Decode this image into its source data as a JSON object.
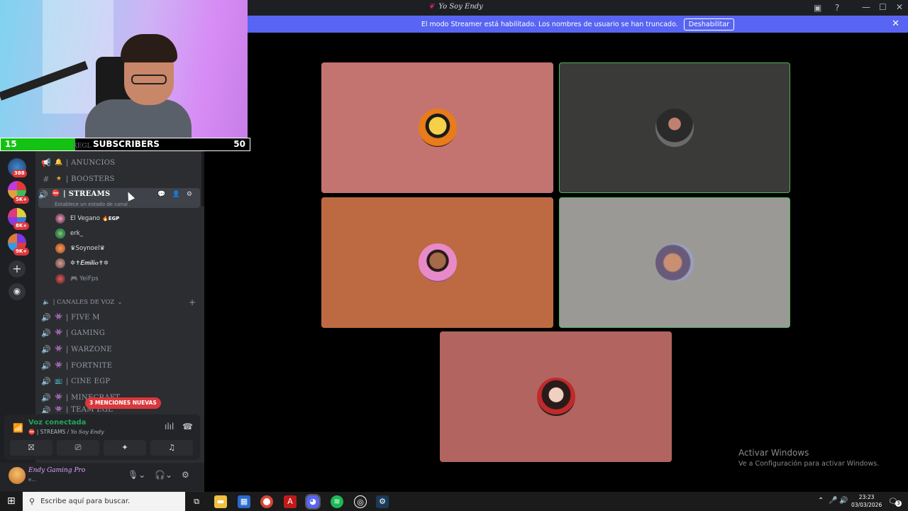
{
  "window": {
    "title": "Yo Soy Endy",
    "inbox_icon": "inbox-icon",
    "help_icon": "help-icon",
    "minimize": "—",
    "maximize": "☐",
    "close": "✕"
  },
  "banner": {
    "text": "El modo Streamer está habilitado. Los nombres de usuario se han truncado.",
    "button": "Deshabilitar",
    "close": "✕",
    "color": "#5865f2"
  },
  "overlay": {
    "left_count": "15",
    "label": "SUBSCRIBERS",
    "right_count": "50",
    "progress": 0.3,
    "fill_color": "#13c213"
  },
  "rail": {
    "badges": [
      "388",
      "5K+",
      "8K+",
      "9K+"
    ],
    "add_label": "+",
    "explore_label": "◉"
  },
  "channels": {
    "truncated_header": "REGL",
    "items": [
      {
        "name": "| ANUNCIOS",
        "icon": "megaphone-icon",
        "emoji": "🔔"
      },
      {
        "name": "| BOOSTERS",
        "icon": "hashtag-icon",
        "emoji": "★"
      },
      {
        "name": "| STREAMS",
        "icon": "speaker-icon",
        "emoji": "⛔",
        "status": "Establece un estado de canal"
      }
    ],
    "members": [
      {
        "name": "El Vegano",
        "tag": "🔥EGP"
      },
      {
        "name": "erk_",
        "tag": ""
      },
      {
        "name": "♛Soynoel♛",
        "tag": ""
      },
      {
        "name": "✲✝𝑬𝒎𝒊𝒍𝒊𝒐✝✲",
        "tag": ""
      },
      {
        "name": "🎮 YeiFps",
        "tag": ""
      }
    ],
    "voice_category": "| CANALES DE VOZ",
    "voice_channels": [
      "| FIVE M",
      "|  GAMING",
      "| WARZONE",
      "| FORTNITE",
      "| CINE EGP",
      "| MINECRAFT"
    ],
    "cut_channel": "| TEAM EGL",
    "mentions": "3 MENCIONES NUEVAS"
  },
  "voice": {
    "status": "Voz conectada",
    "channel": "| STREAMS / ",
    "server": "Yo Soy Endy"
  },
  "user": {
    "name": "Endy Gaming Pro",
    "status": "e..."
  },
  "grid": {
    "tiles": [
      {
        "color": "#c37471",
        "avatar": "avatar-sunglasses"
      },
      {
        "color": "#3a3a38",
        "avatar": "avatar-person"
      },
      {
        "color": "#bd6a42",
        "avatar": "avatar-cartoon-face"
      },
      {
        "color": "#9a9996",
        "avatar": "avatar-photo"
      },
      {
        "color": "#b26460",
        "avatar": "avatar-yei"
      }
    ],
    "speaking_color": "#4bb55a"
  },
  "activate": {
    "line1": "Activar Windows",
    "line2": "Ve a Configuración para activar Windows."
  },
  "taskbar": {
    "search": "Escribe aquí para buscar.",
    "time": "23:23",
    "date": "03/03/2026",
    "notifications": "3"
  }
}
